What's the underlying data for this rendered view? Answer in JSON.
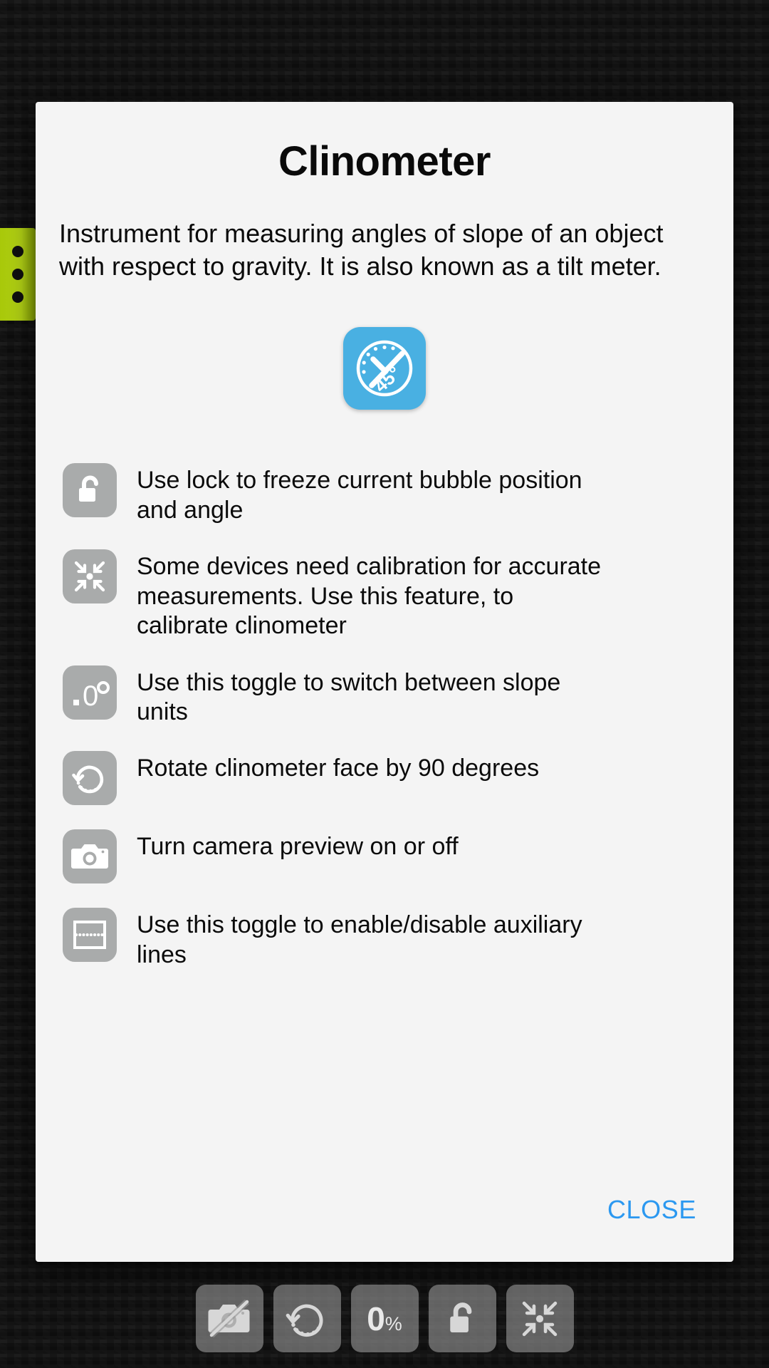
{
  "dialog": {
    "title": "Clinometer",
    "description": "Instrument for measuring angles of slope of an object with respect to gravity. It is also known as a tilt meter.",
    "app_icon": {
      "name": "clinometer-app-icon",
      "label": "45°",
      "background_color": "#49b0e2"
    },
    "close_label": "CLOSE",
    "close_color": "#2b98f0",
    "background_color": "#f4f4f4"
  },
  "features": [
    {
      "icon": "unlock-icon",
      "text": "Use lock to freeze current bubble position and angle"
    },
    {
      "icon": "calibrate-icon",
      "text": "Some devices need calibration for accurate measurements. Use this feature, to calibrate clinometer"
    },
    {
      "icon": "decimal-degree-icon",
      "text": "Use this toggle to switch between slope units",
      "label": ".0°"
    },
    {
      "icon": "rotate-icon",
      "text": "Rotate clinometer face by 90 degrees"
    },
    {
      "icon": "camera-icon",
      "text": "Turn camera preview on or off"
    },
    {
      "icon": "auxiliary-lines-icon",
      "text": "Use this toggle to enable/disable auxiliary lines"
    }
  ],
  "toolbar": {
    "buttons": [
      {
        "name": "camera-off-button",
        "icon": "camera-off-icon"
      },
      {
        "name": "rotate-button",
        "icon": "rotate-icon"
      },
      {
        "name": "slope-unit-button",
        "icon": "percent-value",
        "value": "0",
        "unit": "%"
      },
      {
        "name": "lock-button",
        "icon": "unlock-icon"
      },
      {
        "name": "calibrate-button",
        "icon": "calibrate-icon"
      }
    ]
  },
  "side_tab": {
    "name": "drawer-handle",
    "color": "#b0ce10",
    "dots": 3
  }
}
